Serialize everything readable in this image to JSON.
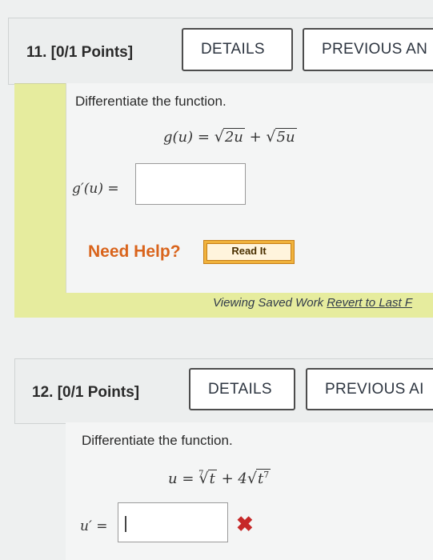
{
  "problem11": {
    "title": "11.  [0/1 Points]",
    "details_label": "DETAILS",
    "previous_label": "PREVIOUS AN",
    "prompt": "Differentiate the function.",
    "eq_lhs": "g(u) =",
    "eq_rad1": "2u",
    "eq_plus": "+",
    "eq_rad2": "5u",
    "answer_label": "g′(u) =",
    "answer_value": "",
    "need_help": "Need Help?",
    "read_it": "Read It",
    "saved_text": "Viewing Saved Work",
    "revert_text": "Revert to Last F"
  },
  "problem12": {
    "title": "12.  [0/1 Points]",
    "details_label": "DETAILS",
    "previous_label": "PREVIOUS AI",
    "prompt": "Differentiate the function.",
    "eq_lhs": "u =",
    "eq_root_index": "7",
    "eq_rad1": "t",
    "eq_plus": "+ 4",
    "eq_rad2_base": "t",
    "eq_rad2_exp": "7",
    "answer_label": "u′ =",
    "answer_value": "",
    "incorrect_mark": "✖"
  },
  "colors": {
    "help_orange": "#d9641c",
    "highlight_green": "#e6ec9e",
    "incorrect_red": "#c62828"
  }
}
